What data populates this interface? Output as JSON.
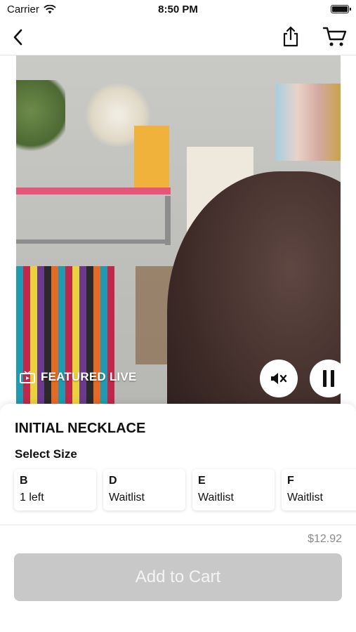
{
  "status_bar": {
    "carrier": "Carrier",
    "time": "8:50 PM"
  },
  "nav": {
    "back_icon": "chevron-left-icon",
    "share_icon": "share-icon",
    "cart_icon": "cart-icon"
  },
  "video": {
    "badge": "FEATURED LIVE",
    "mute_icon": "speaker-mute-icon",
    "pause_icon": "pause-icon"
  },
  "product": {
    "title": "INITIAL NECKLACE",
    "select_label": "Select Size",
    "sizes": [
      {
        "size": "B",
        "status": "1 left"
      },
      {
        "size": "D",
        "status": "Waitlist"
      },
      {
        "size": "E",
        "status": "Waitlist"
      },
      {
        "size": "F",
        "status": "Waitlist"
      }
    ],
    "price": "$12.92"
  },
  "footer": {
    "add_to_cart": "Add to Cart"
  },
  "colors": {
    "button_disabled": "#c8c8c8",
    "price": "#8a8a8a",
    "shelf_accent": "#e9547a"
  }
}
